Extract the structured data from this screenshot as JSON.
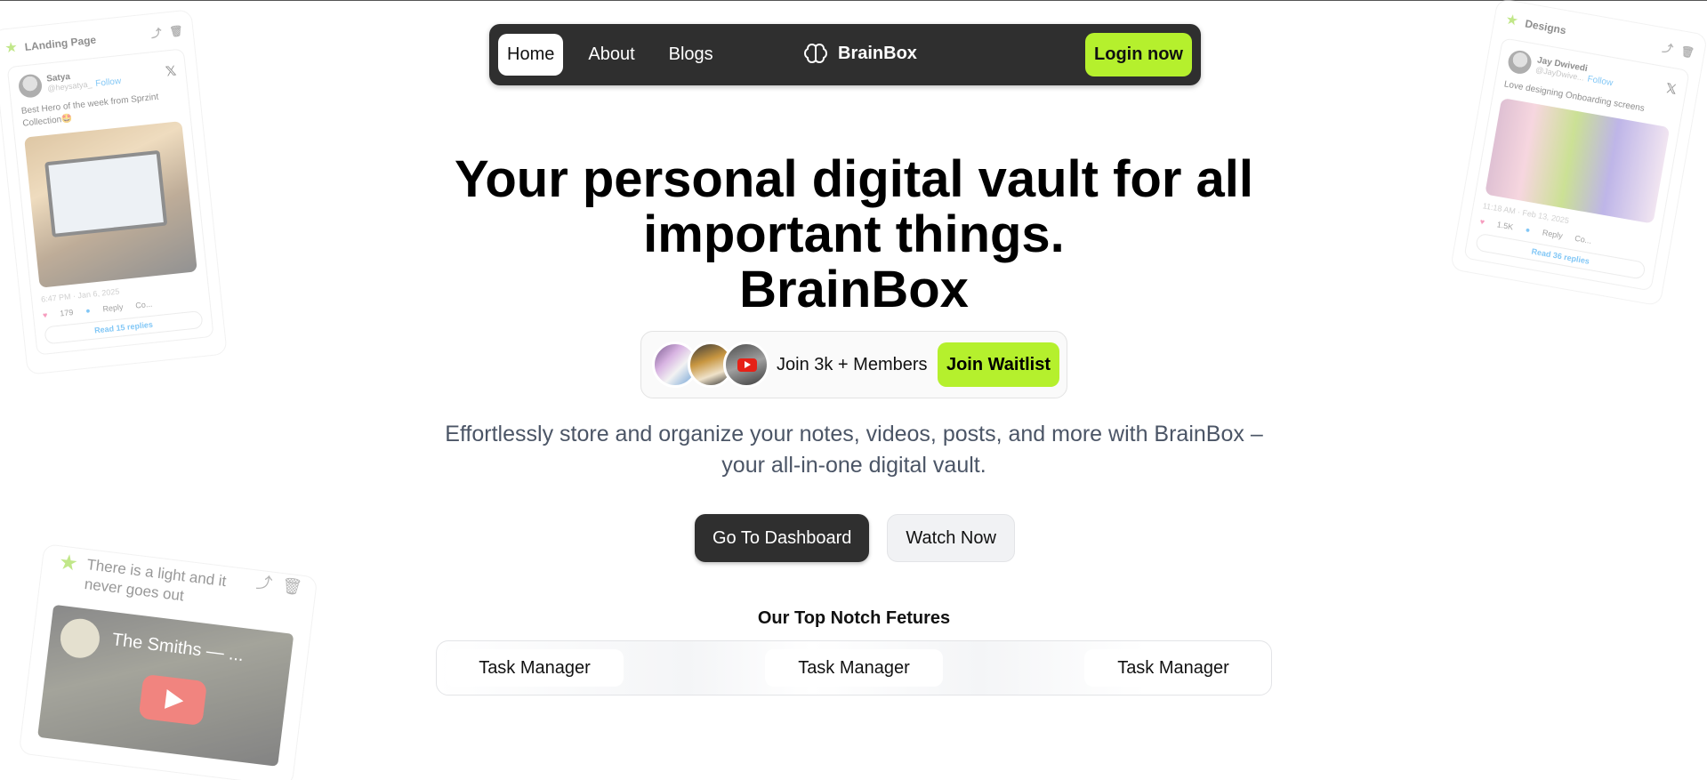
{
  "nav": {
    "links": [
      {
        "label": "Home",
        "active": true
      },
      {
        "label": "About",
        "active": false
      },
      {
        "label": "Blogs",
        "active": false
      }
    ],
    "brand": "BrainBox",
    "login_label": "Login now"
  },
  "hero": {
    "title_line1": "Your personal digital vault for all",
    "title_line2": "important things.",
    "title_line3": "BrainBox",
    "members_text": "Join 3k + Members",
    "waitlist_label": "Join Waitlist",
    "subtitle_line1": "Effortlessly store and organize your notes, videos, posts, and more with BrainBox –",
    "subtitle_line2": "your all-in-one digital vault.",
    "dashboard_label": "Go To Dashboard",
    "watch_label": "Watch Now"
  },
  "features": {
    "title": "Our Top Notch Fetures",
    "items": [
      "Task Manager",
      "Task Manager",
      "Task Manager"
    ]
  },
  "cards": {
    "left": {
      "title": "LAnding Page",
      "user": "Satya",
      "handle": "@heysatya_",
      "follow": "Follow",
      "text": "Best Hero of the week from Sprzint Collection🤩",
      "time": "6:47 PM · Jan 6, 2025",
      "likes": "179",
      "reply": "Reply",
      "copy": "Co...",
      "read": "Read 15 replies"
    },
    "right": {
      "title": "Designs",
      "user": "Jay Dwivedi",
      "handle": "@JayDwive...",
      "follow": "Follow",
      "text": "Love designing Onboarding screens",
      "time": "11:18 AM · Feb 13, 2025",
      "likes": "1.5K",
      "reply": "Reply",
      "copy": "Co...",
      "read": "Read 36 replies"
    },
    "bottom": {
      "quote": "There is a light and it never goes out",
      "video_title": "The Smiths — ..."
    }
  },
  "colors": {
    "accent": "#b5f02d",
    "nav_bg": "#2f2f2f"
  }
}
